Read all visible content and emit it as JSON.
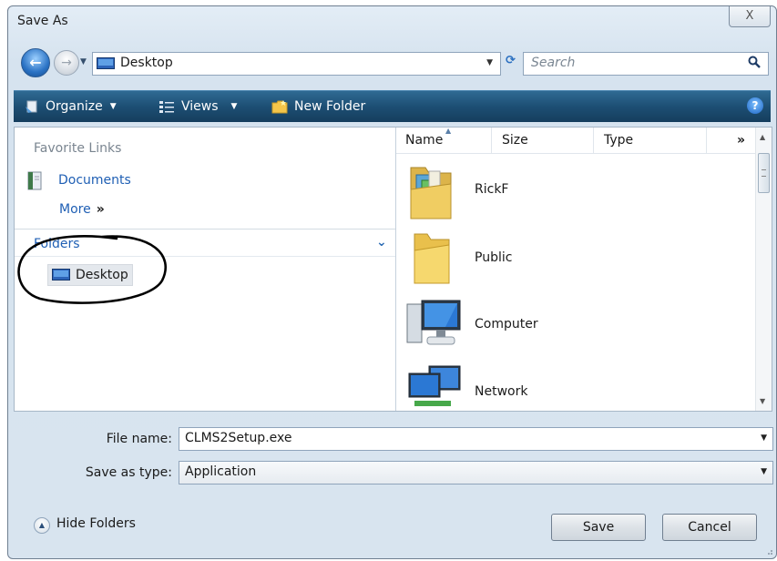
{
  "window": {
    "title": "Save As",
    "close_glyph": "X"
  },
  "nav": {
    "address": "Desktop",
    "search_placeholder": "Search"
  },
  "toolbar": {
    "organize": "Organize",
    "views": "Views",
    "new_folder": "New Folder",
    "help": "?"
  },
  "left_pane": {
    "favorite_links_title": "Favorite Links",
    "documents": "Documents",
    "more": "More",
    "more_chevron": "»",
    "folders": "Folders",
    "tree_selected": "Desktop"
  },
  "columns": [
    "Name",
    "Size",
    "Type"
  ],
  "columns_more": "»",
  "items": [
    {
      "name": "RickF",
      "icon": "user-folder-icon"
    },
    {
      "name": "Public",
      "icon": "folder-icon"
    },
    {
      "name": "Computer",
      "icon": "computer-icon"
    },
    {
      "name": "Network",
      "icon": "network-icon"
    }
  ],
  "form": {
    "file_name_label": "File name:",
    "file_name_value": "CLMS2Setup.exe",
    "save_type_label": "Save as type:",
    "save_type_value": "Application"
  },
  "footer": {
    "hide_folders": "Hide Folders",
    "save": "Save",
    "cancel": "Cancel"
  },
  "annotation": {
    "color": "#000000",
    "shape": "hand-drawn ellipse around Folders / Desktop"
  },
  "colors": {
    "toolbar": "#1d4f74",
    "link": "#1f5fb4",
    "window_bg": "#d8e4ef"
  }
}
